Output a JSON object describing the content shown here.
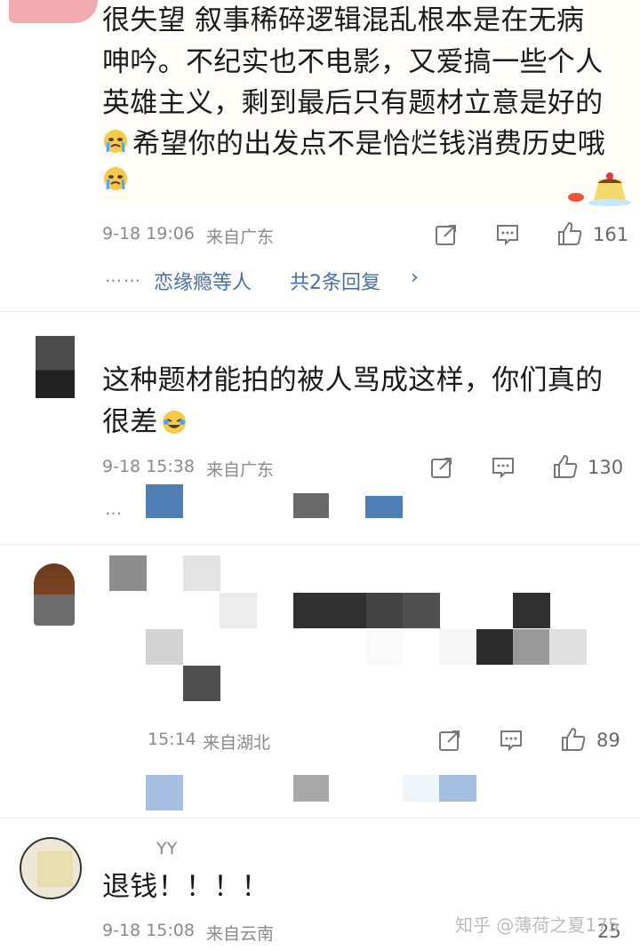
{
  "comments": [
    {
      "text_lines": [
        "很失望 叙事稀碎逻辑混乱根本是在无病",
        "呻吟。不纪实也不电影，又爱搞一些个人",
        "英雄主义，剩到最后只有题材立意是好的",
        "希望你的出发点不是恰烂钱消费历史哦"
      ],
      "date": "9-18 19:06",
      "location": "来自广东",
      "likes": "161",
      "reply_prefix": "恋缘瘾等人",
      "reply_text": "共2条回复",
      "emoji": "crying-emoji"
    },
    {
      "text_lines": [
        "这种题材能拍的被人骂成这样，你们真的",
        "很差"
      ],
      "date": "9-18 15:38",
      "location": "来自广东",
      "likes": "130"
    },
    {
      "date": "15:14",
      "location": "来自湖北",
      "likes": "89"
    },
    {
      "username": "YY",
      "text": "退钱！！！！",
      "date": "9-18 15:08",
      "location": "来自云南",
      "likes": "25"
    }
  ],
  "watermark": "知乎 @薄荷之夏175",
  "colors": {
    "link": "#4a6fa5",
    "meta": "#8a8a8a"
  }
}
